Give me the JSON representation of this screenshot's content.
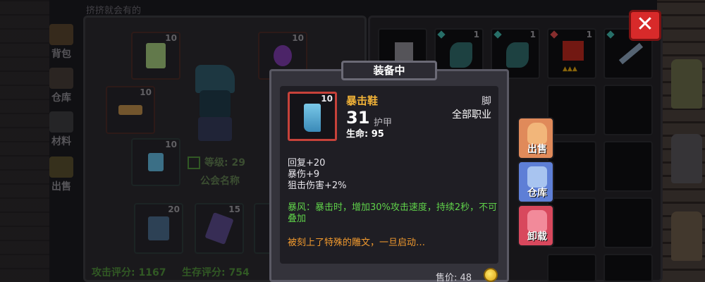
{
  "side_tabs": [
    {
      "label": "背包",
      "icon": "backpack-icon"
    },
    {
      "label": "仓库",
      "icon": "warehouse-icon"
    },
    {
      "label": "材料",
      "icon": "materials-icon"
    },
    {
      "label": "出售",
      "icon": "gold-icon"
    }
  ],
  "character": {
    "panel_title": "挤挤就会有的",
    "hero_label": "挤挤就会有的",
    "level_label": "等级: 29",
    "guild_label": "公会名称",
    "attack_score": "攻击评分: 1167",
    "survival_score": "生存评分: 754",
    "slots": [
      {
        "count": "10",
        "icon": "robe-icon"
      },
      {
        "count": "10",
        "icon": "amulet-icon"
      },
      {
        "count": "10",
        "icon": "gloves-icon"
      },
      {
        "count": "10",
        "icon": "boots-icon"
      },
      {
        "count": "20",
        "icon": "helmet-icon"
      },
      {
        "count": "15",
        "icon": "scythe-icon"
      },
      {
        "count": "",
        "icon": "scythe-icon"
      }
    ]
  },
  "inventory_grid": {
    "top_row": [
      {
        "count": "",
        "icon": "tower-icon"
      },
      {
        "count": "1",
        "icon": "scythe-icon"
      },
      {
        "count": "1",
        "icon": "scythe-icon"
      },
      {
        "count": "1",
        "icon": "crown-icon"
      },
      {
        "count": "1",
        "icon": "sword-icon"
      }
    ]
  },
  "close_label": "✕",
  "tooltip": {
    "header": "装备中",
    "item_count": "10",
    "item_name": "暴击鞋",
    "slot_type": "脚",
    "armor_value": "31",
    "armor_label": "护甲",
    "class_restriction": "全部职业",
    "hp_line": "生命:  95",
    "stat_lines": [
      "回复+20",
      "暴伤+9",
      "狙击伤害+2%"
    ],
    "set_effect": "暴风：暴击时，增加30%攻击速度，持续2秒，不可叠加",
    "engraving": "被刻上了特殊的雕文，一旦启动…",
    "price": "售价: 48"
  },
  "actions": [
    {
      "label": "出售",
      "icon": "pouch-icon"
    },
    {
      "label": "仓库",
      "icon": "warehouse-icon"
    },
    {
      "label": "卸载",
      "icon": "shirt-icon"
    }
  ],
  "colors": {
    "item_name": "#f2b338",
    "set_effect": "#5fd14a",
    "engraving": "#f29a2e",
    "close_bg": "#d82a2a",
    "sell_btn": "#e08a5a",
    "warehouse_btn": "#5e7fd6",
    "unequip_btn": "#d8485d"
  }
}
